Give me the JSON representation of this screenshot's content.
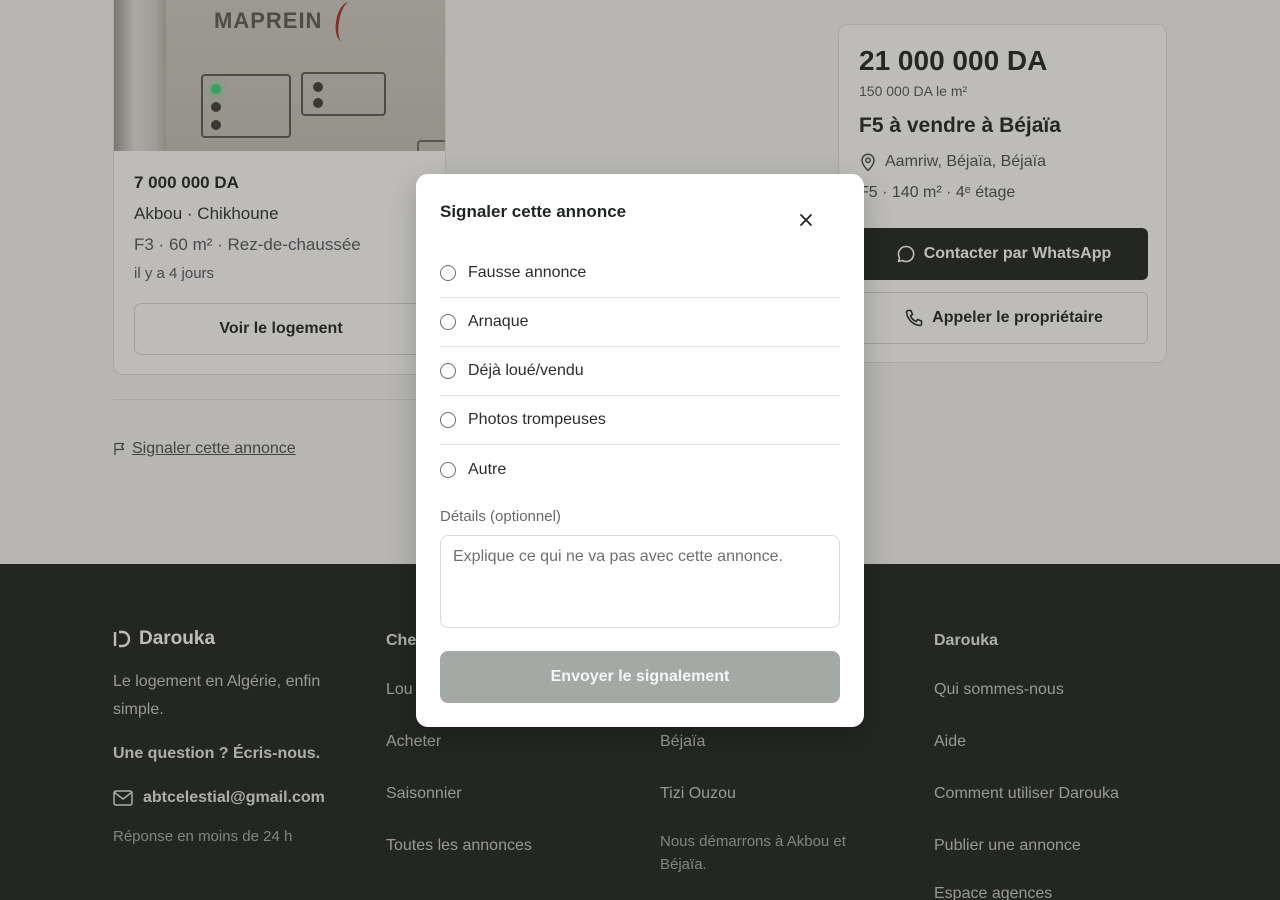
{
  "listing_card": {
    "photo_brand": "MAPREIN",
    "price": "7 000 000 DA",
    "place": "Akbou · Chikhoune",
    "specs": "F3 · 60 m² · Rez-de-chaussée",
    "date": "il y a 4 jours",
    "view_button": "Voir le logement"
  },
  "report_link": {
    "label": "Signaler cette annonce",
    "icon": "flag-icon"
  },
  "detail_card": {
    "price": "21 000 000 DA",
    "price_per_m2": "150 000 DA le m²",
    "title": "F5 à vendre à Béjaïa",
    "location": "Aamriw, Béjaïa, Béjaïa",
    "location_icon": "map-pin-icon",
    "specs": "F5 · 140 m² · 4ᵉ étage",
    "whatsapp_button": "Contacter par WhatsApp",
    "whatsapp_icon": "chat-bubble-icon",
    "call_button": "Appeler le propriétaire",
    "call_icon": "phone-icon"
  },
  "footer": {
    "brand": "Darouka",
    "tagline": "Le logement en Algérie, enfin simple.",
    "question": "Une question ? Écris-nous.",
    "email": "abtcelestial@gmail.com",
    "email_icon": "mail-icon",
    "reply_time": "Réponse en moins de 24 h",
    "col1": {
      "heading": "Che",
      "items": [
        "Lou",
        "Acheter",
        "Saisonnier",
        "Toutes les annonces"
      ]
    },
    "col2": {
      "items": [
        "Béjaïa",
        "Tizi Ouzou",
        "Nous démarrons à Akbou et Béjaïa."
      ]
    },
    "col3": {
      "heading": "Darouka",
      "items": [
        "Qui sommes-nous",
        "Aide",
        "Comment utiliser Darouka",
        "Publier une annonce",
        "Espace agences"
      ]
    }
  },
  "modal": {
    "title": "Signaler cette annonce",
    "close_icon": "close-icon",
    "options": [
      "Fausse annonce",
      "Arnaque",
      "Déjà loué/vendu",
      "Photos trompeuses",
      "Autre"
    ],
    "details_label": "Détails (optionnel)",
    "details_placeholder": "Explique ce qui ne va pas avec cette annonce.",
    "details_value": "",
    "submit": "Envoyer le signalement"
  },
  "colors": {
    "dark": "#1c231f",
    "page_bg": "#f7f6f3",
    "submit_disabled": "#a5a9a6"
  }
}
